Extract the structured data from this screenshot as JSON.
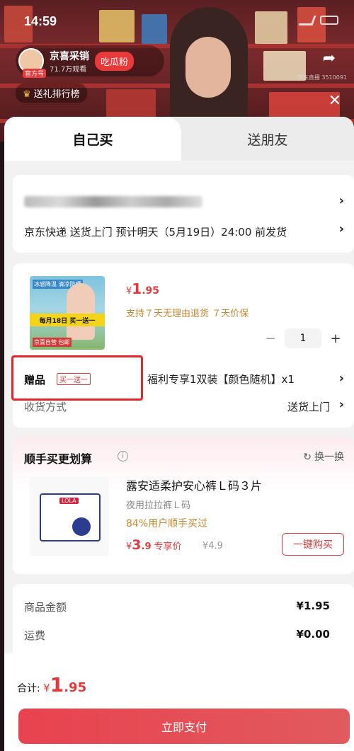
{
  "status": {
    "time": "14:59"
  },
  "live": {
    "host_name": "京喜采销",
    "host_views": "71.7万观看",
    "host_badge": "官方号",
    "follow_label": "吃瓜粉",
    "rank_label": "送礼排行榜",
    "stream_id": "京东直播 3510091"
  },
  "tabs": {
    "self": "自己买",
    "gift": "送朋友"
  },
  "address": {
    "delivery": "京东快递 送货上门 预计明天（5月19日）24:00 前发货"
  },
  "product": {
    "image_tag_top": "冰感降温 清凉防晒",
    "image_deal": "每月18日 买一送一",
    "image_tag_bottom": "京喜自营 包邮",
    "price_symbol": "¥",
    "price_int": "1",
    "price_dec": ".95",
    "guarantee": "支持７天无理由退货  ７天价保",
    "quantity": "1"
  },
  "gift": {
    "label": "赠品",
    "badge": "买一送一",
    "desc": "福利专享1双装【颜色随机】x1"
  },
  "shipping": {
    "label": "收货方式",
    "value": "送货上门"
  },
  "recommend": {
    "title": "顺手买更划算",
    "refresh_label": "换一换",
    "image_brand": "LOLA",
    "name": "露安适柔护安心裤Ｌ码３片",
    "sub": "夜用拉拉裤Ｌ码",
    "percent": "84%用户顺手买过",
    "price_symbol": "¥",
    "price_int": "3",
    "price_dec": ".9",
    "price_tag": "专享价",
    "orig_price": "¥4.9",
    "buy_label": "一键购买"
  },
  "summary": {
    "goods_label": "商品金额",
    "goods_value": "¥1.95",
    "freight_label": "运费",
    "freight_value": "¥0.00"
  },
  "footer": {
    "total_label": "合计:",
    "total_symbol": "¥",
    "total_int": "1",
    "total_dec": ".95",
    "pay_label": "立即支付"
  },
  "colors": {
    "accent": "#e4393c",
    "gold": "#c8882e",
    "highlight": "#e2262b"
  },
  "icons": [
    "location-icon",
    "share-icon",
    "close-icon",
    "chevron-right-icon",
    "info-icon",
    "refresh-icon"
  ]
}
